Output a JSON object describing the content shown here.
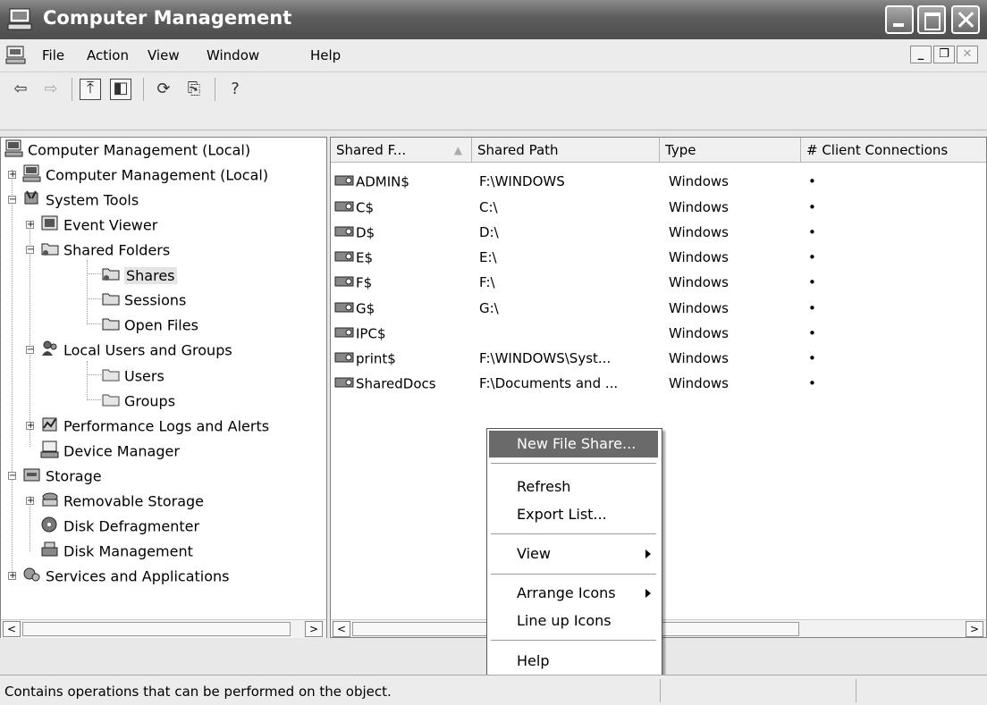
{
  "window": {
    "title": "Computer Management"
  },
  "menu": {
    "items": [
      "File",
      "Action",
      "View",
      "Window",
      "Help"
    ]
  },
  "toolbar": {
    "icons": [
      "back-arrow-icon",
      "forward-arrow-icon",
      "up-folder-icon",
      "show-hide-tree-icon",
      "refresh-icon",
      "export-list-icon",
      "help-icon"
    ]
  },
  "tree": {
    "nodes": [
      {
        "label": "Computer Management (Local)"
      },
      {
        "label": "Computer Management (Local)"
      },
      {
        "label": "System Tools"
      },
      {
        "label": "Event Viewer"
      },
      {
        "label": "Shared Folders"
      },
      {
        "label": "Shares"
      },
      {
        "label": "Sessions"
      },
      {
        "label": "Open Files"
      },
      {
        "label": "Local Users and Groups"
      },
      {
        "label": "Users"
      },
      {
        "label": "Groups"
      },
      {
        "label": "Performance Logs and Alerts"
      },
      {
        "label": "Device Manager"
      },
      {
        "label": "Storage"
      },
      {
        "label": "Removable Storage"
      },
      {
        "label": "Disk Defragmenter"
      },
      {
        "label": "Disk Management"
      },
      {
        "label": "Services and Applications"
      }
    ]
  },
  "list": {
    "columns": [
      "Shared F...",
      "Shared Path",
      "Type",
      "# Client Connections"
    ],
    "rows": [
      {
        "name": "ADMIN$",
        "path": "F:\\WINDOWS",
        "type": "Windows",
        "connections": "•"
      },
      {
        "name": "C$",
        "path": "C:\\",
        "type": "Windows",
        "connections": "•"
      },
      {
        "name": "D$",
        "path": "D:\\",
        "type": "Windows",
        "connections": "•"
      },
      {
        "name": "E$",
        "path": "E:\\",
        "type": "Windows",
        "connections": "•"
      },
      {
        "name": "F$",
        "path": "F:\\",
        "type": "Windows",
        "connections": "•"
      },
      {
        "name": "G$",
        "path": "G:\\",
        "type": "Windows",
        "connections": "•"
      },
      {
        "name": "IPC$",
        "path": "",
        "type": "Windows",
        "connections": "•"
      },
      {
        "name": "print$",
        "path": "F:\\WINDOWS\\Syst...",
        "type": "Windows",
        "connections": "•"
      },
      {
        "name": "SharedDocs",
        "path": "F:\\Documents and ...",
        "type": "Windows",
        "connections": "•"
      }
    ]
  },
  "context_menu": {
    "new_file_share": "New File Share...",
    "refresh": "Refresh",
    "export_list": "Export List...",
    "view": "View",
    "arrange_icons": "Arrange Icons",
    "line_up_icons": "Line up Icons",
    "help": "Help"
  },
  "status": {
    "text": "Contains operations that can be performed on the object."
  }
}
